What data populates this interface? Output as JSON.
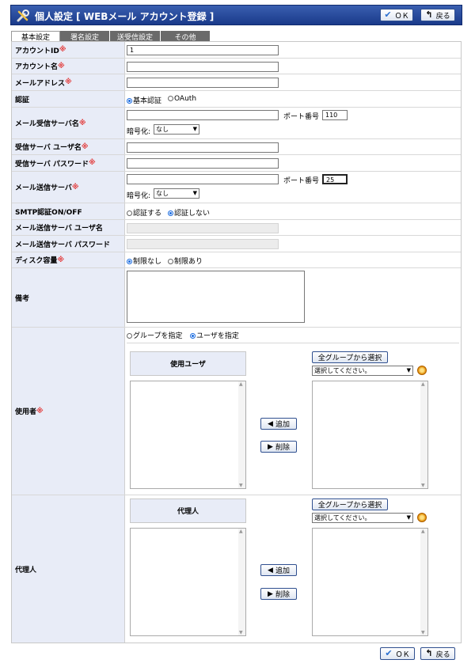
{
  "header": {
    "title": "個人設定 [ WEBメール アカウント登録 ]",
    "ok_label": "ＯＫ",
    "back_label": "戻る"
  },
  "tabs": [
    {
      "label": "基本設定",
      "active": true
    },
    {
      "label": "署名設定",
      "active": false
    },
    {
      "label": "送受信設定",
      "active": false
    },
    {
      "label": "その他",
      "active": false
    }
  ],
  "required_mark": "※",
  "form": {
    "account_id": {
      "label": "アカウントID",
      "value": "1"
    },
    "account_name": {
      "label": "アカウント名",
      "value": ""
    },
    "email": {
      "label": "メールアドレス",
      "value": ""
    },
    "auth": {
      "label": "認証",
      "options": [
        "基本認証",
        "OAuth"
      ],
      "selected": "基本認証"
    },
    "recv_server": {
      "label": "メール受信サーバ名",
      "value": "",
      "port_label": "ポート番号",
      "port": "110",
      "enc_label": "暗号化:",
      "enc_value": "なし"
    },
    "recv_user": {
      "label": "受信サーバ ユーザ名",
      "value": ""
    },
    "recv_pass": {
      "label": "受信サーバ パスワード",
      "value": ""
    },
    "send_server": {
      "label": "メール送信サーバ",
      "value": "",
      "port_label": "ポート番号",
      "port": "25",
      "enc_label": "暗号化:",
      "enc_value": "なし"
    },
    "smtp_auth": {
      "label": "SMTP認証ON/OFF",
      "options": [
        "認証する",
        "認証しない"
      ],
      "selected": "認証しない"
    },
    "send_user": {
      "label": "メール送信サーバ ユーザ名",
      "value": ""
    },
    "send_pass": {
      "label": "メール送信サーバ パスワード",
      "value": ""
    },
    "disk": {
      "label": "ディスク容量",
      "options": [
        "制限なし",
        "制限あり"
      ],
      "selected": "制限なし"
    },
    "note": {
      "label": "備考",
      "value": ""
    },
    "users": {
      "label": "使用者",
      "options": [
        "グループを指定",
        "ユーザを指定"
      ],
      "selected": "ユーザを指定",
      "list_header": "使用ユーザ",
      "add_label": "追加",
      "remove_label": "削除",
      "all_groups_label": "全グループから選択",
      "select_placeholder": "選択してください。"
    },
    "proxy": {
      "label": "代理人",
      "list_header": "代理人",
      "add_label": "追加",
      "remove_label": "削除",
      "all_groups_label": "全グループから選択",
      "select_placeholder": "選択してください。"
    }
  },
  "footer": {
    "ok_label": "ＯＫ",
    "back_label": "戻る"
  }
}
